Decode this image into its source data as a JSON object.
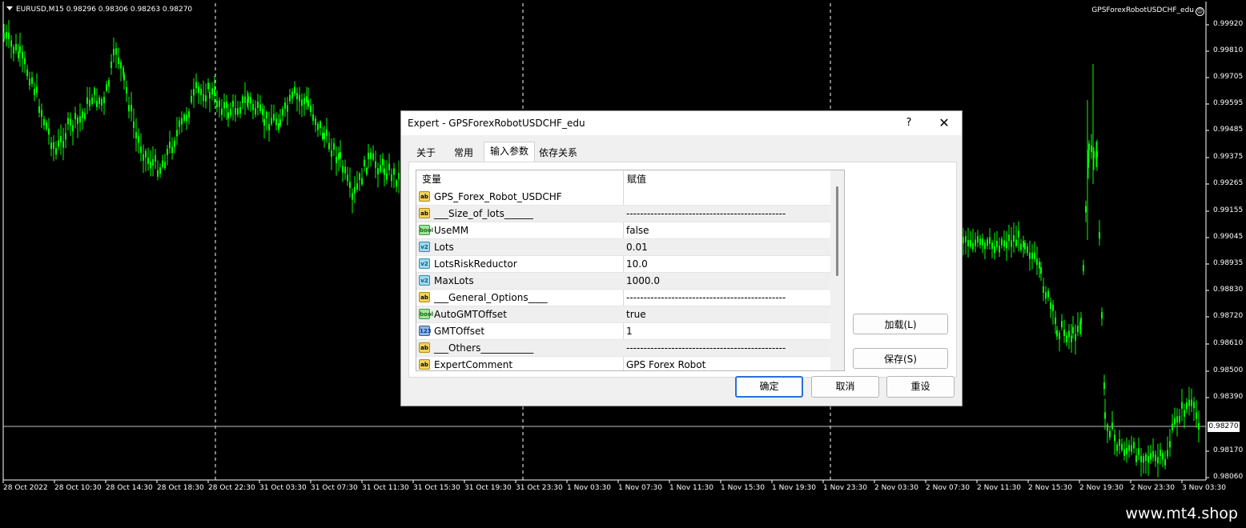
{
  "chart": {
    "symbol_info": "EURUSD,M15  0.98296 0.98306 0.98263 0.98270",
    "expert_name": "GPSForexRobotUSDCHF_edu",
    "current_price": "0.98270",
    "price_labels": [
      "0.99920",
      "0.99810",
      "0.99705",
      "0.99595",
      "0.99485",
      "0.99375",
      "0.99265",
      "0.99155",
      "0.99045",
      "0.98935",
      "0.98830",
      "0.98720",
      "0.98610",
      "0.98500",
      "0.98390",
      "0.98170",
      "0.98060"
    ],
    "time_labels": [
      "28 Oct 2022",
      "28 Oct 10:30",
      "28 Oct 14:30",
      "28 Oct 18:30",
      "28 Oct 22:30",
      "31 Oct 03:30",
      "31 Oct 07:30",
      "31 Oct 11:30",
      "31 Oct 15:30",
      "31 Oct 19:30",
      "31 Oct 23:30",
      "1 Nov 03:30",
      "1 Nov 07:30",
      "1 Nov 11:30",
      "1 Nov 15:30",
      "1 Nov 19:30",
      "1 Nov 23:30",
      "2 Nov 03:30",
      "2 Nov 07:30",
      "2 Nov 11:30",
      "2 Nov 15:30",
      "2 Nov 19:30",
      "2 Nov 23:30",
      "3 Nov 03:30"
    ],
    "candle_color": "#00ff00",
    "background_color": "#000000"
  },
  "dialog": {
    "title": "Expert - GPSForexRobotUSDCHF_edu",
    "help": "?",
    "close": "✕",
    "tabs": [
      "关于",
      "常用",
      "输入参数",
      "依存关系"
    ],
    "active_tab": "输入参数",
    "table": {
      "col_variable": "变量",
      "col_value": "赋值",
      "rows": [
        {
          "type": "string",
          "icon": "ab",
          "variable": "GPS_Forex_Robot_USDCHF",
          "value": ""
        },
        {
          "type": "string",
          "icon": "ab",
          "variable": "___Size_of_lots______",
          "value": "----------------------------------------------"
        },
        {
          "type": "bool",
          "icon": "bool",
          "variable": "UseMM",
          "value": "false"
        },
        {
          "type": "double",
          "icon": "v2",
          "variable": "Lots",
          "value": "0.01"
        },
        {
          "type": "double",
          "icon": "v2",
          "variable": "LotsRiskReductor",
          "value": "10.0"
        },
        {
          "type": "double",
          "icon": "v2",
          "variable": "MaxLots",
          "value": "1000.0"
        },
        {
          "type": "string",
          "icon": "ab",
          "variable": "___General_Options____",
          "value": "----------------------------------------------"
        },
        {
          "type": "bool",
          "icon": "bool",
          "variable": "AutoGMTOffset",
          "value": "true"
        },
        {
          "type": "int",
          "icon": "123",
          "variable": "GMTOffset",
          "value": "1"
        },
        {
          "type": "string",
          "icon": "ab",
          "variable": "___Others___________",
          "value": "----------------------------------------------"
        },
        {
          "type": "string",
          "icon": "ab",
          "variable": "ExpertComment",
          "value": "GPS Forex Robot"
        }
      ]
    },
    "load_button": "加载(L)",
    "save_button": "保存(S)",
    "ok_button": "确定",
    "cancel_button": "取消",
    "reset_button": "重设"
  },
  "footer": {
    "watermark": "www.mt4.shop"
  }
}
